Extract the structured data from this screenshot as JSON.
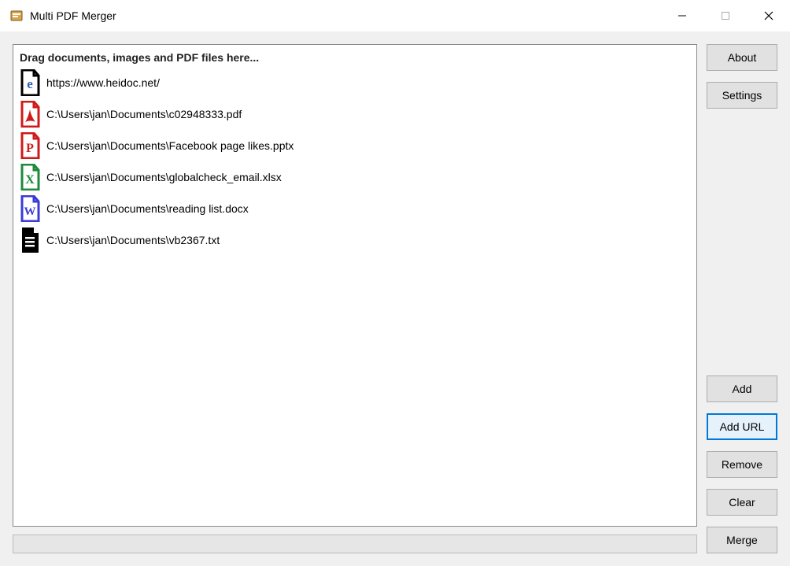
{
  "window": {
    "title": "Multi PDF Merger"
  },
  "list": {
    "hint": "Drag documents, images and PDF files here...",
    "items": [
      {
        "icon": "edge",
        "path": "https://www.heidoc.net/"
      },
      {
        "icon": "pdf",
        "path": "C:\\Users\\jan\\Documents\\c02948333.pdf"
      },
      {
        "icon": "pptx",
        "path": "C:\\Users\\jan\\Documents\\Facebook page likes.pptx"
      },
      {
        "icon": "xlsx",
        "path": "C:\\Users\\jan\\Documents\\globalcheck_email.xlsx"
      },
      {
        "icon": "docx",
        "path": "C:\\Users\\jan\\Documents\\reading list.docx"
      },
      {
        "icon": "txt",
        "path": "C:\\Users\\jan\\Documents\\vb2367.txt"
      }
    ]
  },
  "buttons": {
    "about": "About",
    "settings": "Settings",
    "add": "Add",
    "addurl": "Add URL",
    "remove": "Remove",
    "clear": "Clear",
    "merge": "Merge"
  }
}
